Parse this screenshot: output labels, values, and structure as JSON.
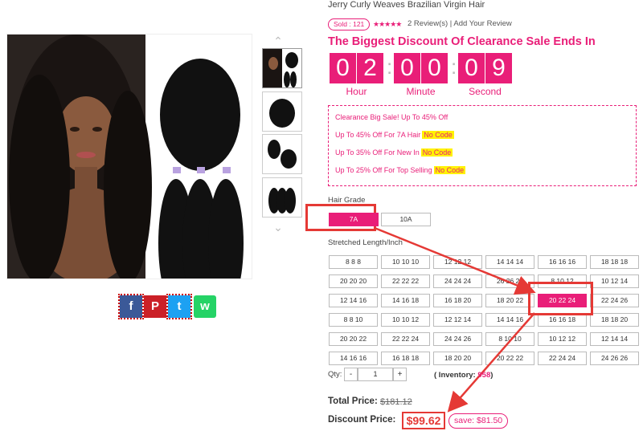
{
  "product": {
    "title": "Jerry Curly Weaves Brazilian Virgin Hair",
    "sold_badge": "Sold : 121",
    "stars": "★★★★★",
    "reviews": "2 Review(s)",
    "add_review": "| Add Your Review"
  },
  "countdown": {
    "heading": "The Biggest Discount Of Clearance Sale Ends In",
    "digits": [
      "0",
      "2",
      "0",
      "0",
      "0",
      "9"
    ],
    "separator": ":",
    "units": [
      "Hour",
      "Minute",
      "Second"
    ]
  },
  "promo": {
    "lines": [
      {
        "text": "Clearance Big Sale! Up To 45% Off",
        "code": ""
      },
      {
        "text": "Up To 45% Off For 7A Hair",
        "code": "No Code"
      },
      {
        "text": "Up To 35% Off For New In",
        "code": "No Code"
      },
      {
        "text": "Up To 25% Off For Top Selling",
        "code": "No Code"
      }
    ]
  },
  "hair_grade": {
    "label": "Hair Grade",
    "options": [
      "7A",
      "10A"
    ],
    "selected": "7A"
  },
  "length": {
    "label": "Stretched Length/Inch",
    "options": [
      "8 8 8",
      "10 10 10",
      "12 12 12",
      "14 14 14",
      "16 16 16",
      "18 18 18",
      "20 20 20",
      "22 22 22",
      "24 24 24",
      "26 26 26",
      "8 10 12",
      "10 12 14",
      "12 14 16",
      "14 16 18",
      "16 18 20",
      "18 20 22",
      "20 22 24",
      "22 24 26",
      "8 8 10",
      "10 10 12",
      "12 12 14",
      "14 14 16",
      "16 16 18",
      "18 18 20",
      "20 20 22",
      "22 22 24",
      "24 24 26",
      "8 10 10",
      "10 12 12",
      "12 14 14",
      "14 16 16",
      "16 18 18",
      "18 20 20",
      "20 22 22",
      "22 24 24",
      "24 26 26"
    ],
    "selected": "20 22 24"
  },
  "quantity": {
    "label": "Qty:",
    "minus": "-",
    "value": "1",
    "plus": "+",
    "inventory_label": "( Inventory:",
    "inventory_value": "958",
    "inventory_close": ")"
  },
  "price": {
    "total_label": "Total Price:",
    "total_value": "$181.12",
    "discount_label": "Discount Price:",
    "discount_value": "$99.62",
    "save": "save: $81.50"
  },
  "social": {
    "facebook": "f",
    "pinterest": "P",
    "twitter": "t",
    "whatsapp": "w"
  },
  "colors": {
    "accent": "#e91e78",
    "annotation": "#e53935",
    "code_bg": "#fff200",
    "facebook": "#3b5998",
    "pinterest": "#cb2027",
    "twitter": "#1da1f2",
    "whatsapp": "#25d366"
  }
}
